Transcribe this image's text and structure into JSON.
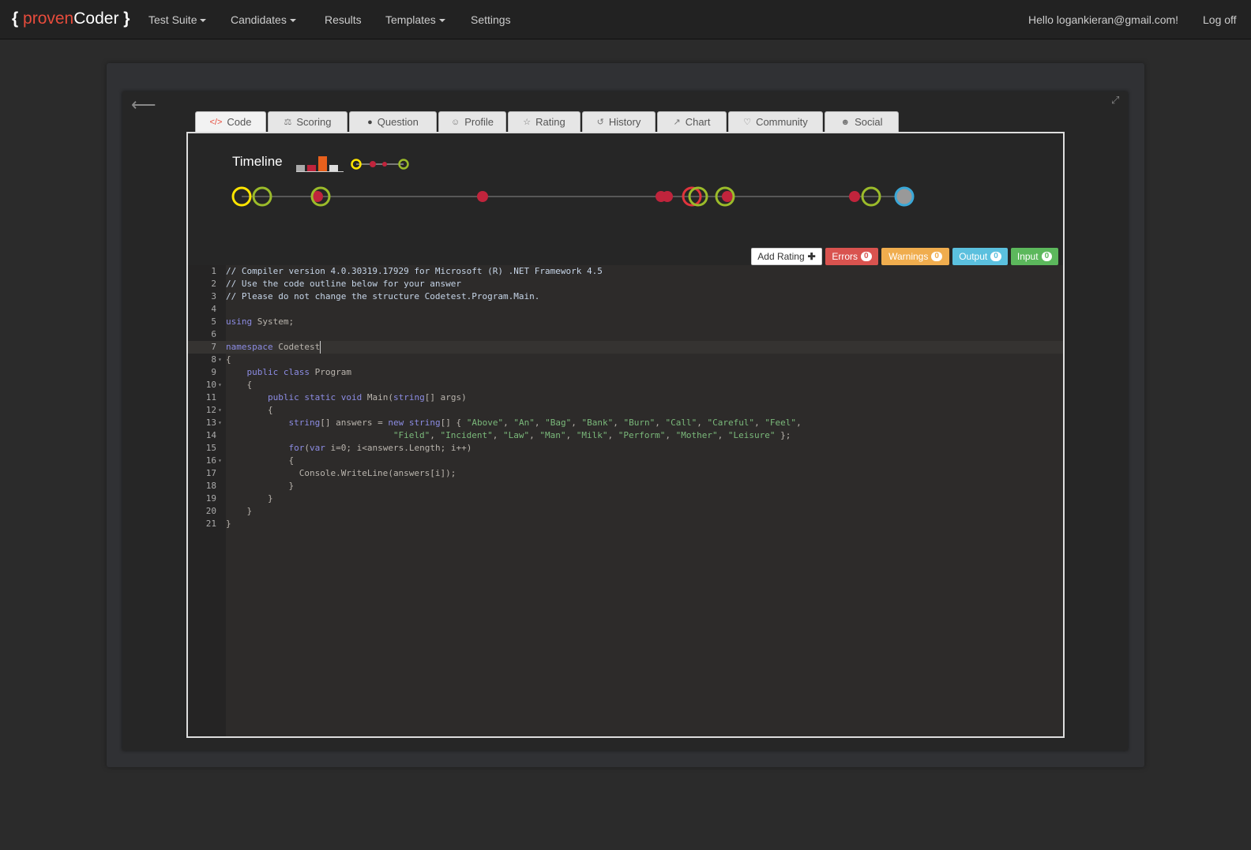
{
  "brand": {
    "open": "{",
    "proven": "proven",
    "coder": "Coder",
    "close": "}"
  },
  "nav": {
    "items": [
      {
        "label": "Test Suite",
        "dropdown": true
      },
      {
        "label": "Candidates",
        "dropdown": true
      },
      {
        "label": "Results",
        "dropdown": false
      },
      {
        "label": "Templates",
        "dropdown": true
      },
      {
        "label": "Settings",
        "dropdown": false
      }
    ],
    "greeting": "Hello logankieran@gmail.com!",
    "logoff": "Log off"
  },
  "tabs": [
    {
      "label": "Code",
      "icon": "code-icon",
      "active": true
    },
    {
      "label": "Scoring",
      "icon": "scale-icon"
    },
    {
      "label": "Question",
      "icon": "dot-icon"
    },
    {
      "label": "Profile",
      "icon": "user-icon"
    },
    {
      "label": "Rating",
      "icon": "star-icon"
    },
    {
      "label": "History",
      "icon": "history-icon"
    },
    {
      "label": "Chart",
      "icon": "chart-icon"
    },
    {
      "label": "Community",
      "icon": "heart-icon"
    },
    {
      "label": "Social",
      "icon": "users-icon"
    }
  ],
  "timeline": {
    "title": "Timeline",
    "colors": {
      "start": "#ffe500",
      "run": "#9bbb2a",
      "error": "#c0243c",
      "current": "#3aa8d8"
    }
  },
  "status": {
    "add_rating": "Add Rating",
    "errors": {
      "label": "Errors",
      "count": "0",
      "color": "#d9534f"
    },
    "warnings": {
      "label": "Warnings",
      "count": "0",
      "color": "#f0ad4e"
    },
    "output": {
      "label": "Output",
      "count": "0",
      "color": "#5bc0de"
    },
    "input": {
      "label": "Input",
      "count": "0",
      "color": "#5cb85c"
    }
  },
  "code": {
    "lines": [
      "// Compiler version 4.0.30319.17929 for Microsoft (R) .NET Framework 4.5",
      "// Use the code outline below for your answer",
      "// Please do not change the structure Codetest.Program.Main.",
      "",
      "using System;",
      "",
      "namespace Codetest",
      "{",
      "    public class Program",
      "    {",
      "        public static void Main(string[] args)",
      "        {",
      "            string[] answers = new string[] { \"Above\", \"An\", \"Bag\", \"Bank\", \"Burn\", \"Call\", \"Careful\", \"Feel\",",
      "                                \"Field\", \"Incident\", \"Law\", \"Man\", \"Milk\", \"Perform\", \"Mother\", \"Leisure\" };",
      "            for(var i=0; i<answers.Length; i++)",
      "            {",
      "              Console.WriteLine(answers[i]);",
      "            }",
      "        }",
      "    }",
      "}"
    ],
    "current_line": 7
  }
}
